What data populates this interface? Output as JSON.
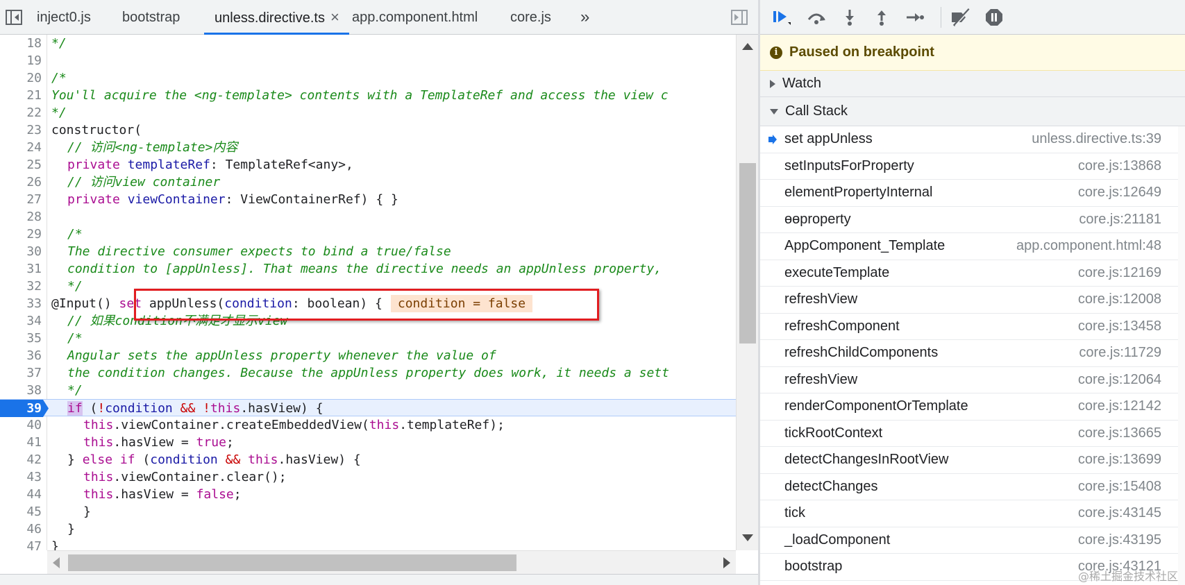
{
  "editor": {
    "tabs": [
      {
        "label": "inject0.js",
        "active": false
      },
      {
        "label": "bootstrap",
        "active": false
      },
      {
        "label": "unless.directive.ts",
        "active": true
      },
      {
        "label": "app.component.html",
        "active": false
      },
      {
        "label": "core.js",
        "active": false
      }
    ],
    "tab_close_glyph": "×",
    "more_tabs_glyph": "»",
    "current_line": 39,
    "inline_value": "condition = false",
    "lines": [
      {
        "n": "18"
      },
      {
        "n": "19"
      },
      {
        "n": "20"
      },
      {
        "n": "21"
      },
      {
        "n": "22"
      },
      {
        "n": "23"
      },
      {
        "n": "24"
      },
      {
        "n": "25"
      },
      {
        "n": "26"
      },
      {
        "n": "27"
      },
      {
        "n": "28"
      },
      {
        "n": "29"
      },
      {
        "n": "30"
      },
      {
        "n": "31"
      },
      {
        "n": "32"
      },
      {
        "n": "33"
      },
      {
        "n": "34"
      },
      {
        "n": "35"
      },
      {
        "n": "36"
      },
      {
        "n": "37"
      },
      {
        "n": "38"
      },
      {
        "n": "39"
      },
      {
        "n": "40"
      },
      {
        "n": "41"
      },
      {
        "n": "42"
      },
      {
        "n": "43"
      },
      {
        "n": "44"
      },
      {
        "n": "45"
      },
      {
        "n": "46"
      },
      {
        "n": "47"
      }
    ],
    "text": {
      "l18": "*/",
      "l20": "/*",
      "l21": "You'll acquire the <ng-template> contents with a TemplateRef and access the view c",
      "l22": "*/",
      "l23": "constructor(",
      "l24": "// 访问<ng-template>内容",
      "l25_kw": "private",
      "l25_prop": "templateRef",
      "l25_rest": ": TemplateRef<any>,",
      "l26": "// 访问view container",
      "l27_kw": "private",
      "l27_prop": "viewContainer",
      "l27_rest": ": ViewContainerRef) { }",
      "l29": "/*",
      "l30": "The directive consumer expects to bind a true/false",
      "l31": "condition to [appUnless]. That means the directive needs an appUnless property,",
      "l32": "*/",
      "l33_dec": "@Input()",
      "l33_kw": "set",
      "l33_a": " appUnless(",
      "l33_prop": "condition",
      "l33_b": ": boolean) {",
      "l34": "// 如果condition不满足才显示view",
      "l35": "/*",
      "l36": "Angular sets the appUnless property whenever the value of",
      "l37": "the condition changes. Because the appUnless property does work, it needs a sett",
      "l38": "*/",
      "l39_kw": "if",
      "l39_a": " (",
      "l39_op": "!",
      "l39_prop": "condition",
      "l39_b": " && ",
      "l39_op2": "!",
      "l39_this": "this",
      "l39_c": ".hasView) {",
      "l40_this": "this",
      "l40_a": ".viewContainer.createEmbeddedView(",
      "l40_this2": "this",
      "l40_b": ".templateRef);",
      "l41_this": "this",
      "l41_a": ".hasView = ",
      "l41_val": "true",
      "l41_b": ";",
      "l42_a": "} ",
      "l42_kw": "else if",
      "l42_b": " (",
      "l42_prop": "condition",
      "l42_c": " && ",
      "l42_this": "this",
      "l42_d": ".hasView) {",
      "l43_this": "this",
      "l43_a": ".viewContainer.clear();",
      "l44_this": "this",
      "l44_a": ".hasView = ",
      "l44_val": "false",
      "l44_b": ";",
      "l45": "}",
      "l46": "}",
      "l47": "}"
    }
  },
  "debugger": {
    "paused_message": "Paused on breakpoint",
    "watch_label": "Watch",
    "callstack_label": "Call Stack",
    "frames": [
      {
        "name": "set appUnless",
        "location": "unless.directive.ts:39",
        "current": true
      },
      {
        "name": "setInputsForProperty",
        "location": "core.js:13868"
      },
      {
        "name": "elementPropertyInternal",
        "location": "core.js:12649"
      },
      {
        "name": "ɵɵproperty",
        "location": "core.js:21181"
      },
      {
        "name": "AppComponent_Template",
        "location": "app.component.html:48"
      },
      {
        "name": "executeTemplate",
        "location": "core.js:12169"
      },
      {
        "name": "refreshView",
        "location": "core.js:12008"
      },
      {
        "name": "refreshComponent",
        "location": "core.js:13458"
      },
      {
        "name": "refreshChildComponents",
        "location": "core.js:11729"
      },
      {
        "name": "refreshView",
        "location": "core.js:12064"
      },
      {
        "name": "renderComponentOrTemplate",
        "location": "core.js:12142"
      },
      {
        "name": "tickRootContext",
        "location": "core.js:13665"
      },
      {
        "name": "detectChangesInRootView",
        "location": "core.js:13699"
      },
      {
        "name": "detectChanges",
        "location": "core.js:15408"
      },
      {
        "name": "tick",
        "location": "core.js:43145"
      },
      {
        "name": "_loadComponent",
        "location": "core.js:43195"
      },
      {
        "name": "bootstrap",
        "location": "core.js:43121"
      }
    ]
  },
  "watermark": "@稀土掘金技术社区",
  "colors": {
    "accent": "#1a73e8",
    "paused_bg": "#fffbe5",
    "highlight_box": "#e11d21",
    "comment": "#1a8a1a",
    "keyword": "#aa0d91"
  }
}
